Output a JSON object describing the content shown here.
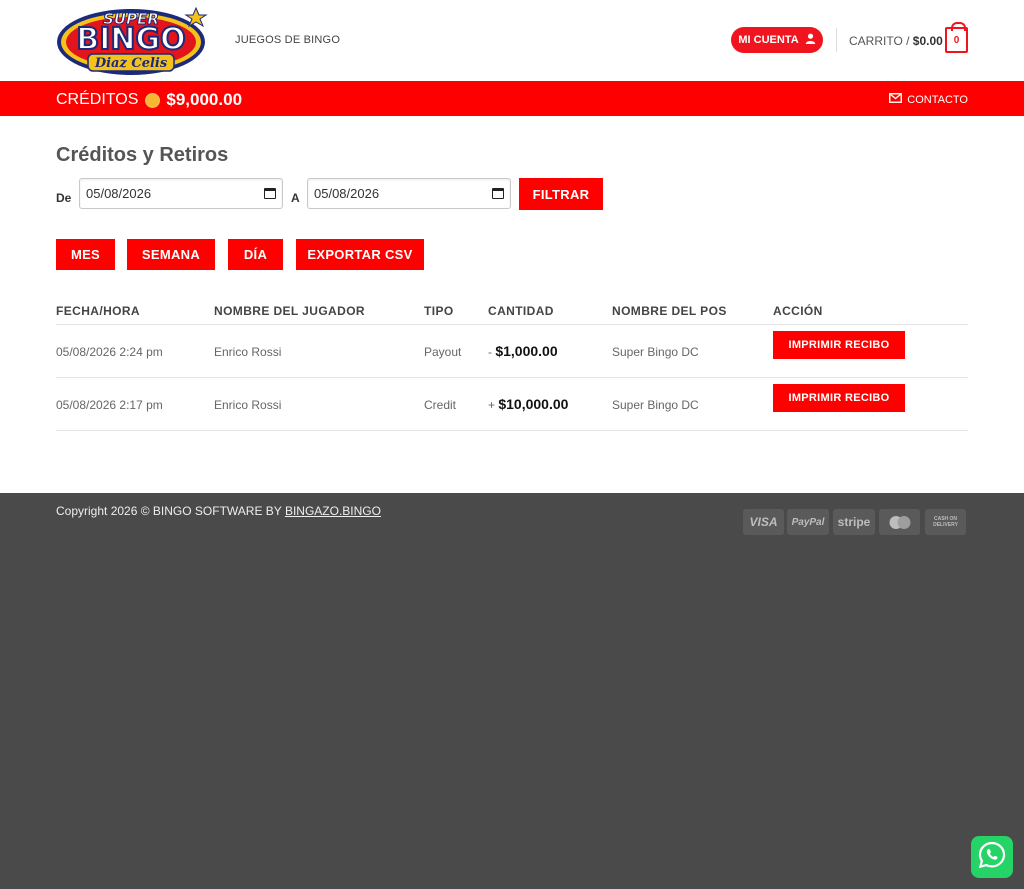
{
  "header": {
    "logo_top": "SUPER",
    "logo_main": "BINGO",
    "logo_sub": "Diaz Celis",
    "nav_games": "JUEGOS DE BINGO",
    "account_label": "MI CUENTA",
    "cart_label": "CARRITO /",
    "cart_total": "$0.00",
    "cart_count": "0"
  },
  "topbar": {
    "credits_label": "CRÉDITOS",
    "credits_amount": "$9,000.00",
    "contact_label": "CONTACTO"
  },
  "page": {
    "title": "Créditos y Retiros",
    "from_label": "De",
    "from_value": "05/08/2026",
    "to_label": "A",
    "to_value": "05/08/2026",
    "filter_button": "FILTRAR",
    "range_buttons": [
      "MES",
      "SEMANA",
      "DÍA",
      "EXPORTAR CSV"
    ]
  },
  "table": {
    "columns": [
      "FECHA/HORA",
      "NOMBRE DEL JUGADOR",
      "TIPO",
      "CANTIDAD",
      "NOMBRE DEL POS",
      "ACCIÓN"
    ],
    "rows": [
      {
        "datetime": "05/08/2026 2:24 pm",
        "player": "Enrico Rossi",
        "type": "Payout",
        "sign": "-",
        "amount": "$1,000.00",
        "pos": "Super Bingo DC",
        "action": "IMPRIMIR RECIBO"
      },
      {
        "datetime": "05/08/2026 2:17 pm",
        "player": "Enrico Rossi",
        "type": "Credit",
        "sign": "+",
        "amount": "$10,000.00",
        "pos": "Super Bingo DC",
        "action": "IMPRIMIR RECIBO"
      }
    ]
  },
  "footer": {
    "copyright_prefix": "Copyright 2026 © BINGO SOFTWARE BY",
    "copyright_link": "BINGAZO.BINGO",
    "payments": [
      "VISA",
      "PayPal",
      "stripe",
      "mastercard",
      "CASH ON DELIVERY"
    ]
  },
  "colors": {
    "brand_red": "#ff0000",
    "footer_bg": "#4a4a4a",
    "whatsapp_green": "#25d366"
  }
}
